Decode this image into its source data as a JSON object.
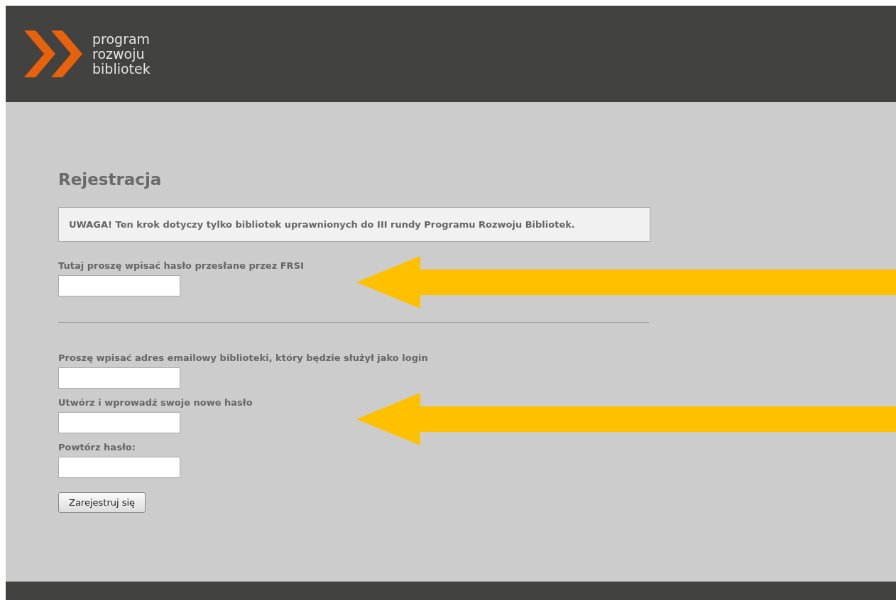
{
  "logo": {
    "lines": [
      "program",
      "rozwoju",
      "bibliotek"
    ]
  },
  "heading": "Rejestracja",
  "notice": "UWAGA! Ten krok dotyczy tylko bibliotek uprawnionych do III rundy Programu Rozwoju Bibliotek.",
  "sections": [
    {
      "fields": [
        {
          "label": "Tutaj proszę wpisać hasło przesłane przez FRSI",
          "annotated": true
        }
      ]
    },
    {
      "fields": [
        {
          "label": "Proszę wpisać adres emailowy biblioteki, który będzie służył jako login",
          "annotated": false
        },
        {
          "label": "Utwórz i wprowadź swoje nowe hasło",
          "annotated": true
        },
        {
          "label": "Powtórz hasło:",
          "annotated": false
        }
      ]
    }
  ],
  "submit": "Zarejestruj się"
}
